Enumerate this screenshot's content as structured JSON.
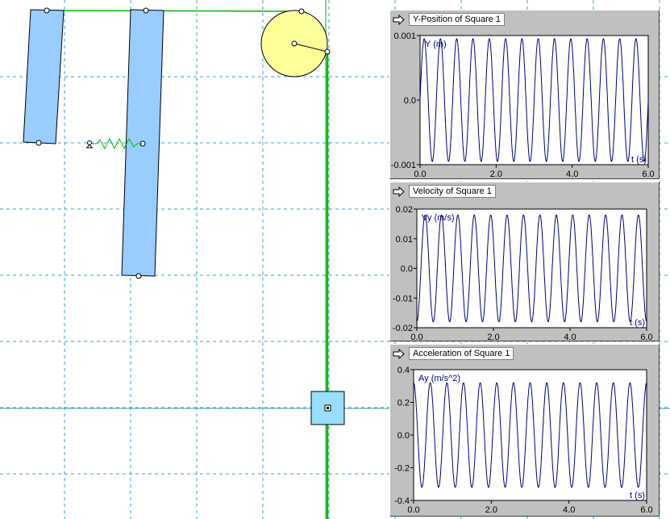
{
  "colors": {
    "grid": "#3ba3c4",
    "body_fill": "#99ccff",
    "body_stroke": "#000000",
    "rope": "#00bb00",
    "pulley_fill": "#ffff99",
    "square_fill": "#99ddff",
    "trace": "#000080",
    "cursor_line": "#3ba3c4"
  },
  "scene": {
    "icons": [
      "anchor-icon"
    ]
  },
  "graphs": [
    {
      "title": "Y-Position of Square 1",
      "y_label": "Y (m)",
      "x_label": "t (s)",
      "y_ticks": [
        "0.001",
        "0.0",
        "-0.001"
      ],
      "x_ticks": [
        "0.0",
        "2.0",
        "4.0",
        "6.0"
      ],
      "icon": "arrow-right-icon"
    },
    {
      "title": "Velocity of Square 1",
      "y_label": "Vy (m/s)",
      "x_label": "t (s)",
      "y_ticks": [
        "0.02",
        "0.01",
        "0.0",
        "-0.01",
        "-0.02"
      ],
      "x_ticks": [
        "0.0",
        "2.0",
        "4.0",
        "6.0"
      ],
      "icon": "arrow-right-icon"
    },
    {
      "title": "Acceleration of Square 1",
      "y_label": "Ay (m/s^2)",
      "x_label": "t (s)",
      "y_ticks": [
        "0.4",
        "0.2",
        "0.0",
        "-0.2",
        "-0.4"
      ],
      "x_ticks": [
        "0.0",
        "2.0",
        "4.0",
        "6.0"
      ],
      "icon": "arrow-right-icon"
    }
  ],
  "chart_data": [
    {
      "type": "line",
      "title": "Y-Position of Square 1",
      "xlabel": "t (s)",
      "ylabel": "Y (m)",
      "xlim": [
        0,
        6
      ],
      "ylim": [
        -0.001,
        0.001
      ],
      "series": [
        {
          "shape": "sine",
          "amplitude": 0.00095,
          "cycles": 14,
          "phase": "sin"
        }
      ]
    },
    {
      "type": "line",
      "title": "Velocity of Square 1",
      "xlabel": "t (s)",
      "ylabel": "Vy (m/s)",
      "xlim": [
        0,
        6
      ],
      "ylim": [
        -0.02,
        0.02
      ],
      "series": [
        {
          "shape": "sine",
          "amplitude": 0.018,
          "cycles": 14,
          "phase": "neg-cos"
        }
      ]
    },
    {
      "type": "line",
      "title": "Acceleration of Square 1",
      "xlabel": "t (s)",
      "ylabel": "Ay (m/s^2)",
      "xlim": [
        0,
        6
      ],
      "ylim": [
        -0.4,
        0.4
      ],
      "series": [
        {
          "shape": "sine",
          "amplitude": 0.32,
          "cycles": 14,
          "phase": "cos"
        }
      ]
    }
  ]
}
